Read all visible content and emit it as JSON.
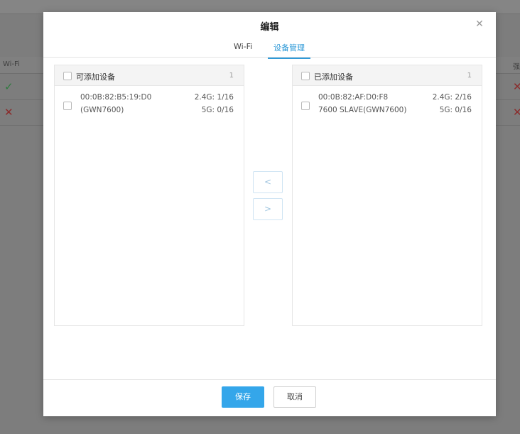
{
  "background": {
    "header": {
      "col_wifi": "Wi-Fi",
      "col_right": "强"
    },
    "rows": [
      {
        "status": "✓",
        "right": "✕"
      },
      {
        "status": "✕",
        "right": "✕"
      }
    ]
  },
  "modal": {
    "title": "编辑",
    "close": "✕",
    "tabs": [
      {
        "label": "Wi-Fi",
        "active": false
      },
      {
        "label": "设备管理",
        "active": true
      }
    ],
    "available": {
      "title": "可添加设备",
      "count": "1",
      "items": [
        {
          "mac": "00:0B:82:B5:19:D0",
          "name": "(GWN7600)",
          "band24": "2.4G: 1/16",
          "band5": "5G: 0/16"
        }
      ]
    },
    "added": {
      "title": "已添加设备",
      "count": "1",
      "items": [
        {
          "mac": "00:0B:82:AF:D0:F8",
          "name": "7600 SLAVE(GWN7600)",
          "band24": "2.4G: 2/16",
          "band5": "5G: 0/16"
        }
      ]
    },
    "move_left": "<",
    "move_right": ">",
    "save": "保存",
    "cancel": "取消"
  },
  "colors": {
    "accent": "#34a6ea",
    "tab_active": "#2f9ad8"
  }
}
